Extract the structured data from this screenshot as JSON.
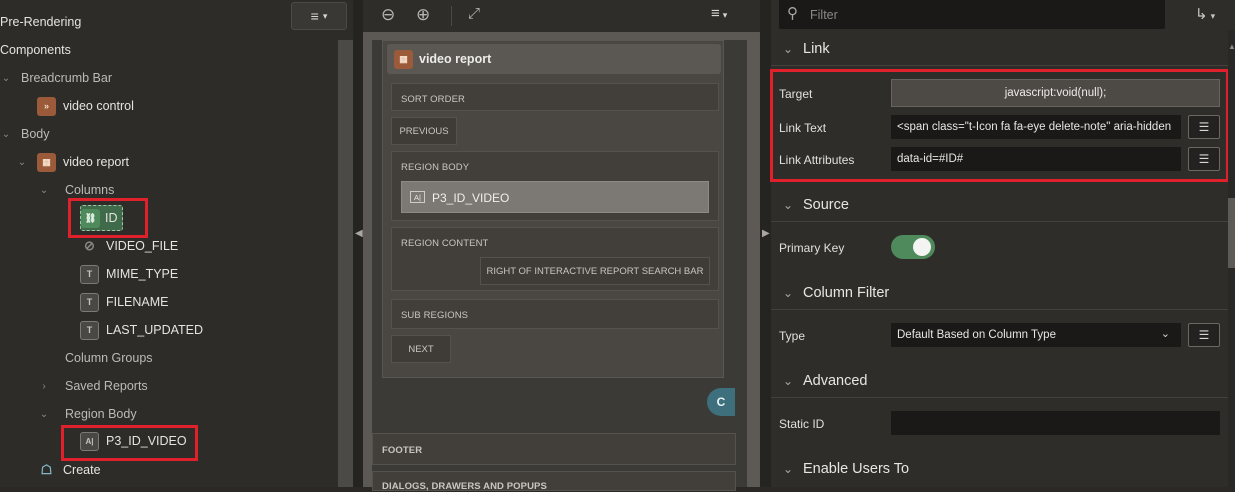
{
  "tree": {
    "pre_rendering": "Pre-Rendering",
    "components": "Components",
    "breadcrumb_bar": "Breadcrumb Bar",
    "video_control": "video control",
    "body": "Body",
    "video_report": "video report",
    "columns": "Columns",
    "col_id": "ID",
    "col_video_file": "VIDEO_FILE",
    "col_mime_type": "MIME_TYPE",
    "col_filename": "FILENAME",
    "col_last_updated": "LAST_UPDATED",
    "column_groups": "Column Groups",
    "saved_reports": "Saved Reports",
    "region_body": "Region Body",
    "p3_id_video": "P3_ID_VIDEO",
    "create": "Create"
  },
  "layout": {
    "region_title": "video report",
    "sort_order": "SORT ORDER",
    "previous": "PREVIOUS",
    "region_body": "REGION BODY",
    "item": "P3_ID_VIDEO",
    "item_icon": "A|",
    "region_content": "REGION CONTENT",
    "right_of_search": "RIGHT OF INTERACTIVE REPORT SEARCH BAR",
    "sub_regions": "SUB REGIONS",
    "next": "NEXT",
    "footer": "FOOTER",
    "dialogs": "DIALOGS, DRAWERS AND POPUPS",
    "fab_label": "C"
  },
  "props": {
    "filter_placeholder": "Filter",
    "link": {
      "title": "Link",
      "target_label": "Target",
      "target_value": "javascript:void(null);",
      "link_text_label": "Link Text",
      "link_text_value": "<span class=\"t-Icon fa fa-eye delete-note\" aria-hidden",
      "link_attr_label": "Link Attributes",
      "link_attr_value": "data-id=#ID#"
    },
    "source": {
      "title": "Source",
      "primary_key_label": "Primary Key",
      "primary_key_on": true
    },
    "column_filter": {
      "title": "Column Filter",
      "type_label": "Type",
      "type_value": "Default Based on Column Type"
    },
    "advanced": {
      "title": "Advanced",
      "static_id_label": "Static ID",
      "static_id_value": ""
    },
    "enable_users": {
      "title": "Enable Users To"
    }
  },
  "colors": {
    "highlight": "#e0202a",
    "toggle_on": "#4f8a5d",
    "region_icon": "#9b5a3a"
  }
}
